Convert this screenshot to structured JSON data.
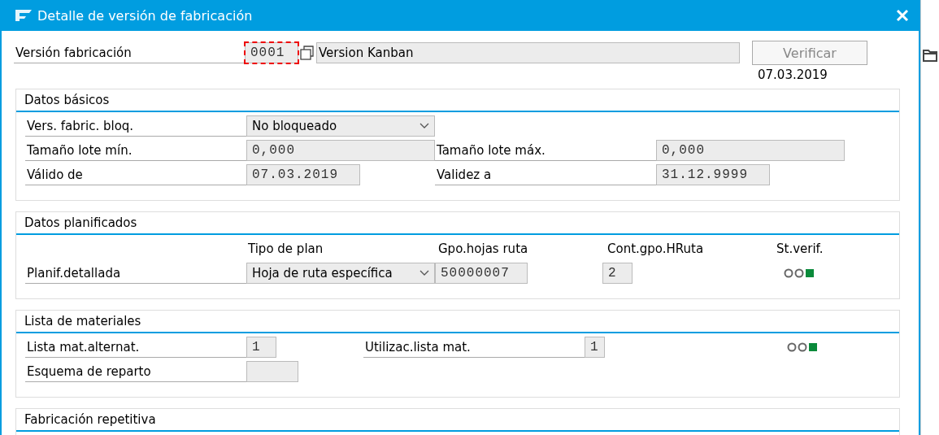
{
  "window": {
    "title": "Detalle de versión de fabricación"
  },
  "version": {
    "label": "Versión fabricación",
    "value": "0001",
    "description": "Version Kanban",
    "focused": true
  },
  "verify_button": {
    "label": "Verificar",
    "disabled": true
  },
  "date": "07.03.2019",
  "basic": {
    "title": "Datos básicos",
    "lock": {
      "label": "Vers. fabric. bloq.",
      "value": "No bloqueado"
    },
    "lot_min": {
      "label": "Tamaño lote mín.",
      "value": "0,000"
    },
    "lot_max": {
      "label": "Tamaño lote máx.",
      "value": "0,000"
    },
    "valid_from": {
      "label": "Válido de",
      "value": "07.03.2019"
    },
    "valid_to": {
      "label": "Validez a",
      "value": "31.12.9999"
    }
  },
  "planning": {
    "title": "Datos planificados",
    "columns": [
      "Tipo de plan",
      "Gpo.hojas ruta",
      "Cont.gpo.HRuta",
      "St.verif."
    ],
    "row": {
      "label": "Planif.detallada",
      "plan_type": "Hoja de ruta específica",
      "group": "50000007",
      "counter": "2",
      "lights": [
        {
          "on": false
        },
        {
          "on": false
        },
        {
          "on": true
        }
      ]
    }
  },
  "bom": {
    "title": "Lista de materiales",
    "alt": {
      "label": "Lista mat.alternat.",
      "value": "1"
    },
    "usage": {
      "label": "Utilizac.lista mat.",
      "value": "1"
    },
    "lights": [
      {
        "on": false
      },
      {
        "on": false
      },
      {
        "on": true
      }
    ],
    "split": {
      "label": "Esquema de reparto"
    }
  },
  "repetitive": {
    "title": "Fabricación repetitiva"
  }
}
